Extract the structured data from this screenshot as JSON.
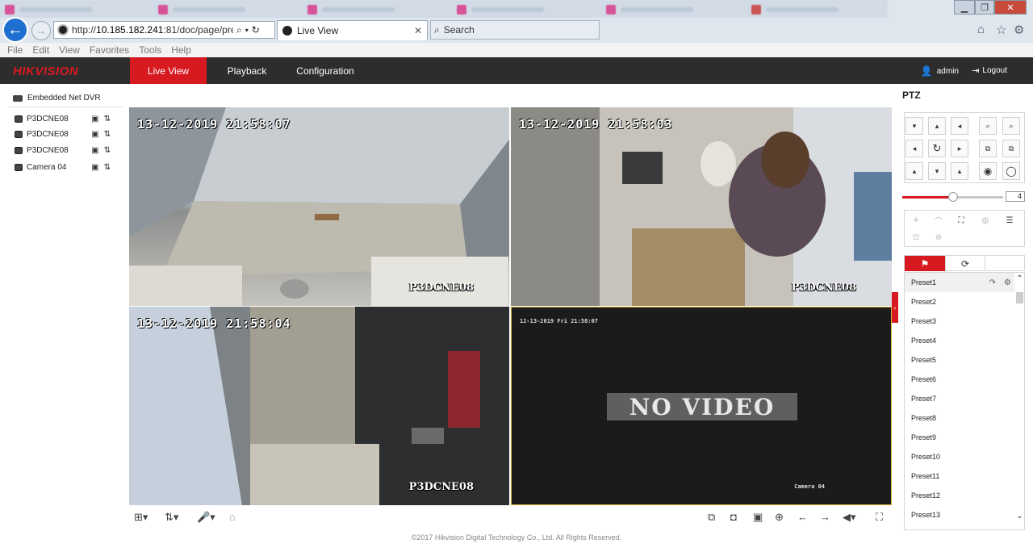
{
  "browser": {
    "address_host": "10.185.182.241",
    "address_prefix": "http://",
    "address_rest": ":81/doc/page/previ",
    "tab_title": "Live View",
    "search_label": "Search"
  },
  "menubar": [
    "File",
    "Edit",
    "View",
    "Favorites",
    "Tools",
    "Help"
  ],
  "app": {
    "logo": "HIKVISION",
    "nav": {
      "live": "Live View",
      "playback": "Playback",
      "configuration": "Configuration"
    },
    "user": "admin",
    "logout": "Logout"
  },
  "left": {
    "device": "Embedded Net DVR",
    "cameras": [
      "P3DCNE08",
      "P3DCNE08",
      "P3DCNE08",
      "Camera 04"
    ]
  },
  "video": {
    "tile1": {
      "time": "13-12-2019 21:58:07",
      "name": "P3DCNE08"
    },
    "tile2": {
      "time": "13-12-2019 21:58:03",
      "name": "P3DCNE08"
    },
    "tile3": {
      "time": "13-12-2019 21:58:04",
      "name": "P3DCNE08"
    },
    "tile4": {
      "time": "12-13-2019 Fri 21:58:07",
      "name": "Camera 04",
      "status": "NO VIDEO"
    }
  },
  "copyright": "©2017 Hikvision Digital Technology Co., Ltd. All Rights Reserved.",
  "ptz": {
    "title": "PTZ",
    "speed": "4",
    "speed_fraction": 0.5,
    "presets": [
      "Preset1",
      "Preset2",
      "Preset3",
      "Preset4",
      "Preset5",
      "Preset6",
      "Preset7",
      "Preset8",
      "Preset9",
      "Preset10",
      "Preset11",
      "Preset12",
      "Preset13"
    ]
  },
  "colors": {
    "brand_red": "#d71920",
    "header_bg": "#2d2d2d",
    "selected_tile_border": "#d7b93a"
  }
}
